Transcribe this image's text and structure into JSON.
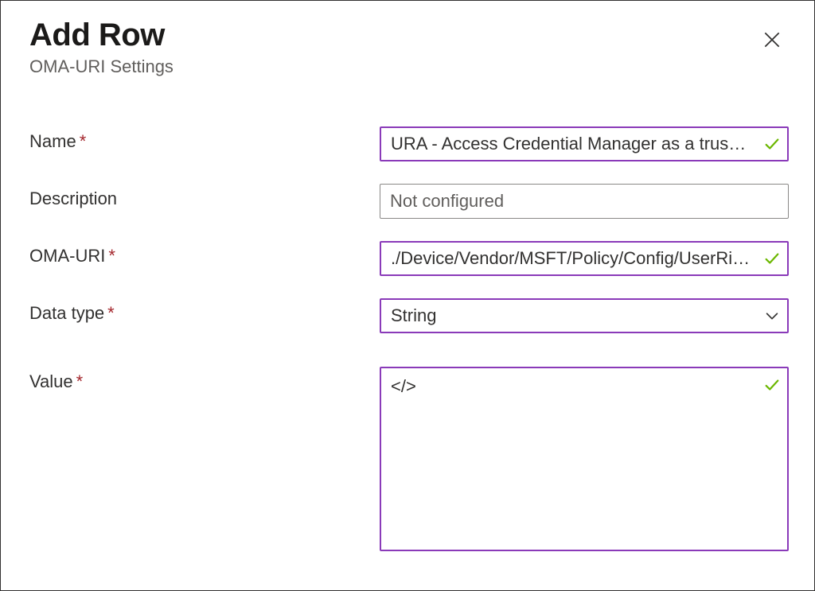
{
  "header": {
    "title": "Add Row",
    "subtitle": "OMA-URI Settings"
  },
  "form": {
    "name": {
      "label": "Name",
      "required": true,
      "value": "URA - Access Credential Manager as a truste…",
      "validated": true
    },
    "description": {
      "label": "Description",
      "required": false,
      "placeholder": "Not configured",
      "value": ""
    },
    "oma_uri": {
      "label": "OMA-URI",
      "required": true,
      "value": "./Device/Vendor/MSFT/Policy/Config/UserRi…",
      "validated": true
    },
    "data_type": {
      "label": "Data type",
      "required": true,
      "selected": "String"
    },
    "value": {
      "label": "Value",
      "required": true,
      "value": "</>",
      "validated": true
    }
  },
  "required_marker": "*"
}
